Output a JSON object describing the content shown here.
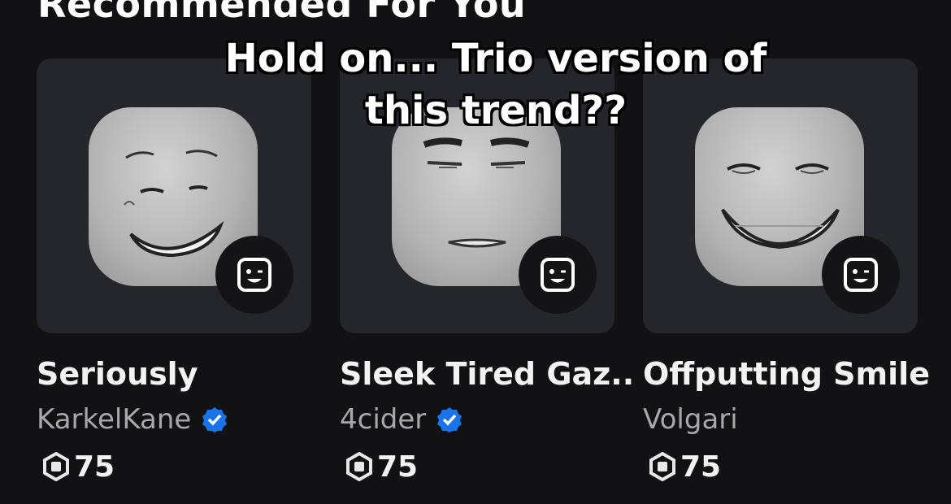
{
  "section": {
    "title": "Recommended For You"
  },
  "caption": {
    "line1": "Hold on... Trio version of",
    "line2": "this trend??"
  },
  "icons": {
    "emote_badge": "emote-face-icon",
    "verified": "verified-badge-icon",
    "currency": "robux-icon"
  },
  "colors": {
    "background": "#121215",
    "card": "#25262b",
    "verified": "#1a73e8",
    "muted_text": "#a7a8ad"
  },
  "items": [
    {
      "name": "Seriously",
      "creator": "KarkelKane",
      "verified": true,
      "price": "75"
    },
    {
      "name": "Sleek Tired Gaz...",
      "creator": "4cider",
      "verified": true,
      "price": "75"
    },
    {
      "name": "Offputting Smile",
      "creator": "Volgari",
      "verified": false,
      "price": "75"
    }
  ]
}
